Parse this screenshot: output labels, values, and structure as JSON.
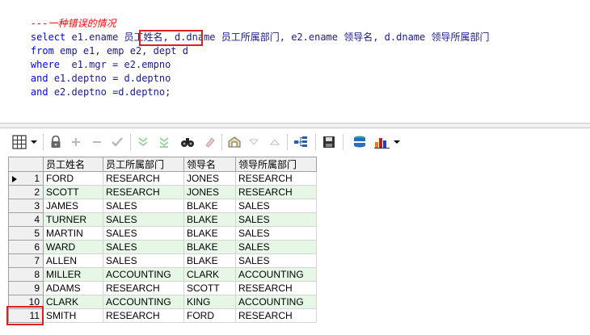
{
  "editor": {
    "comment": "---一种错误的情况",
    "line1_kw": "select",
    "line1_rest": " e1.ename 员工姓名, d.dname 员工所属部门, e2.ename 领导名, d.dname 领导所属部门",
    "line2_kw": "from",
    "line2_rest": " emp e1, emp e2, dept d",
    "line3_kw": "where",
    "line3_rest": "  e1.mgr = e2.empno",
    "line4_kw": "and",
    "line4_rest": " e1.deptno = d.deptno",
    "line5_kw": "and",
    "line5_rest": " e2.deptno =d.deptno;"
  },
  "toolbar": {
    "icons": [
      "grid-view-icon",
      "dropdown-arrow-icon",
      "lock-icon",
      "add-record-icon",
      "delete-record-icon",
      "post-edit-icon",
      "filter-down-icon",
      "filter-clear-icon",
      "find-icon",
      "clear-icon",
      "query-by-example-icon",
      "previous-icon",
      "next-icon",
      "link-icon",
      "save-icon",
      "export-icon",
      "chart-icon",
      "chart-dropdown-icon"
    ]
  },
  "grid": {
    "columns": [
      "员工姓名",
      "员工所属部门",
      "领导名",
      "领导所属部门"
    ],
    "rows": [
      {
        "n": "1",
        "c": [
          "FORD",
          "RESEARCH",
          "JONES",
          "RESEARCH"
        ]
      },
      {
        "n": "2",
        "c": [
          "SCOTT",
          "RESEARCH",
          "JONES",
          "RESEARCH"
        ]
      },
      {
        "n": "3",
        "c": [
          "JAMES",
          "SALES",
          "BLAKE",
          "SALES"
        ]
      },
      {
        "n": "4",
        "c": [
          "TURNER",
          "SALES",
          "BLAKE",
          "SALES"
        ]
      },
      {
        "n": "5",
        "c": [
          "MARTIN",
          "SALES",
          "BLAKE",
          "SALES"
        ]
      },
      {
        "n": "6",
        "c": [
          "WARD",
          "SALES",
          "BLAKE",
          "SALES"
        ]
      },
      {
        "n": "7",
        "c": [
          "ALLEN",
          "SALES",
          "BLAKE",
          "SALES"
        ]
      },
      {
        "n": "8",
        "c": [
          "MILLER",
          "ACCOUNTING",
          "CLARK",
          "ACCOUNTING"
        ]
      },
      {
        "n": "9",
        "c": [
          "ADAMS",
          "RESEARCH",
          "SCOTT",
          "RESEARCH"
        ]
      },
      {
        "n": "10",
        "c": [
          "CLARK",
          "ACCOUNTING",
          "KING",
          "ACCOUNTING"
        ]
      },
      {
        "n": "11",
        "c": [
          "SMITH",
          "RESEARCH",
          "FORD",
          "RESEARCH"
        ]
      }
    ]
  },
  "colors": {
    "highlight": "#e02020",
    "alt_row": "#e6f7e6",
    "keyword": "#0000ff",
    "comment": "#ff0000"
  }
}
